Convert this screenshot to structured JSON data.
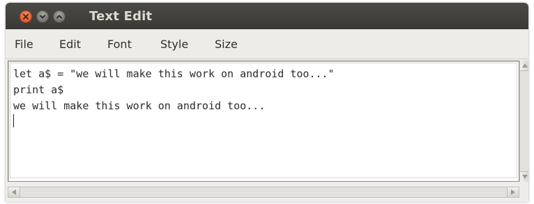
{
  "window": {
    "title": "Text Edit",
    "controls": [
      "close-icon",
      "minimize-icon",
      "maximize-icon"
    ],
    "colors": {
      "titlebar": "#3f3e3a",
      "close": "#e6622f",
      "control": "#85847e"
    }
  },
  "menubar": {
    "items": [
      {
        "label": "File"
      },
      {
        "label": "Edit"
      },
      {
        "label": "Font"
      },
      {
        "label": "Style"
      },
      {
        "label": "Size"
      }
    ]
  },
  "editor": {
    "lines": [
      "let a$ = \"we will make this work on android too...\"",
      "print a$",
      "we will make this work on android too..."
    ]
  }
}
